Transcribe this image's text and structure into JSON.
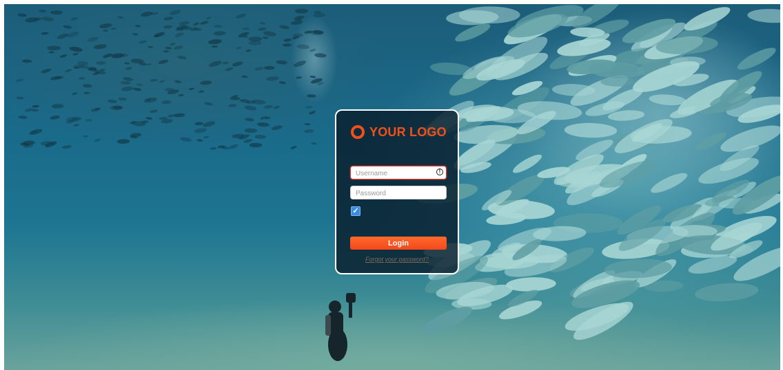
{
  "background": {
    "description_icon": "underwater-fish-photo",
    "colors": {
      "deep": "#1a6a8a",
      "fish": "#9fd0d0",
      "sand": "#6aa39c"
    }
  },
  "login": {
    "logo_text": "YOUR LOGO",
    "username": {
      "placeholder": "Username",
      "value": "",
      "state": "error",
      "icon": "alert-circle-icon"
    },
    "password": {
      "placeholder": "Password",
      "value": ""
    },
    "remember_checked": true,
    "checkbox_glyph": "✓",
    "login_label": "Login",
    "forgot_label": "Forgot your password?"
  },
  "colors": {
    "accent": "#f1501b",
    "error": "#e0352b",
    "checkbox": "#3b8de4",
    "card_bg": "#0a1e2d"
  }
}
